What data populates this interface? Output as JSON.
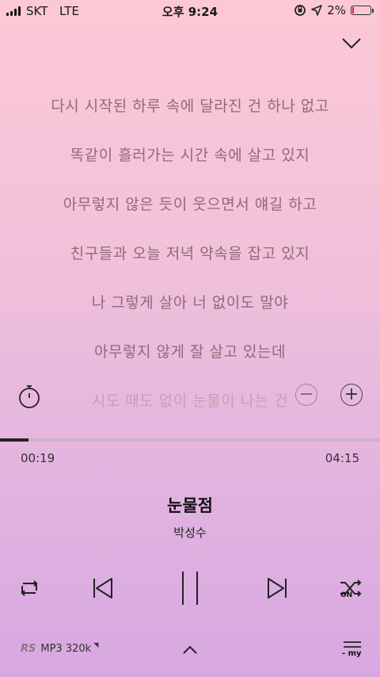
{
  "status_bar": {
    "carrier": "SKT",
    "network": "LTE",
    "time": "오후 9:24",
    "battery_percent": "2%",
    "battery_level": 0.02
  },
  "lyrics": [
    "다시 시작된 하루 속에 달라진 건 하나 없고",
    "똑같이 흘러가는 시간 속에 살고 있지",
    "아무렇지 않은 듯이 웃으면서 얘길 하고",
    "친구들과 오늘 저녁 약속을 잡고 있지",
    "나 그렇게 살아 너 없이도 말야",
    "아무렇지 않게 잘 살고 있는데",
    "시도 때도 없이 눈물이 나는 건"
  ],
  "player": {
    "elapsed": "00:19",
    "total": "04:15",
    "progress": 0.0745,
    "title": "눈물점",
    "artist": "박성수",
    "shuffle_state": "ON"
  },
  "bottom_bar": {
    "rs_label": "RS",
    "quality": "MP3 320k",
    "mylist_label": "- my"
  },
  "icons": {
    "collapse": "chevron-down-icon",
    "timer": "stopwatch-icon",
    "font_smaller": "minus-circle-icon",
    "font_larger": "plus-circle-icon",
    "repeat": "repeat-icon",
    "previous": "skip-previous-icon",
    "pause": "pause-icon",
    "next": "skip-next-icon",
    "shuffle": "shuffle-icon",
    "expand": "chevron-up-icon",
    "playlist": "playlist-icon"
  },
  "colors": {
    "accent": "#222222",
    "lyric": "#8e6b76",
    "battery_low": "#e2202a"
  }
}
